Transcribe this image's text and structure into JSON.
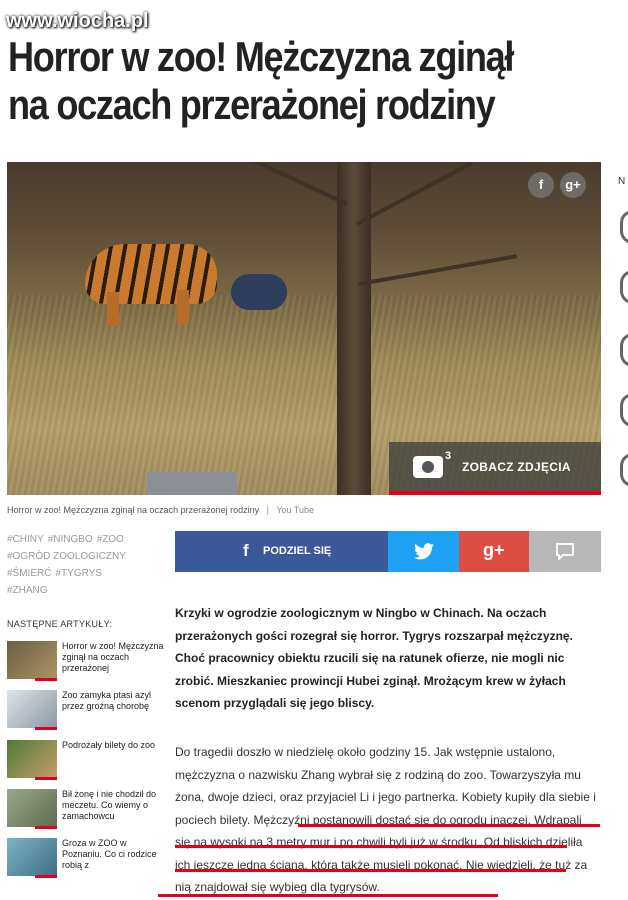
{
  "watermark": "www.wiocha.pl",
  "headline": {
    "line1": "Horror w zoo! Mężczyzna zginął",
    "line2": "na oczach przerażonej rodziny"
  },
  "photo": {
    "share_facebook": "f",
    "share_google": "g+",
    "gallery_count": "3",
    "gallery_label": "ZOBACZ ZDJĘCIA"
  },
  "caption": {
    "text": "Horror w zoo! Mężczyzna zginął na oczach przerażonej rodziny",
    "separator": "|",
    "source": "You Tube"
  },
  "tags": [
    "#CHINY",
    "#NINGBO",
    "#ZOO",
    "#OGRÓD ZOOLOGICZNY",
    "#ŚMIERĆ",
    "#TYGRYS",
    "#ZHANG"
  ],
  "next_articles": {
    "heading": "NASTĘPNE ARTYKUŁY:",
    "items": [
      {
        "title": "Horror w zoo! Mężczyzna zginął na oczach przerażonej",
        "thumb_color": "#8a7a55"
      },
      {
        "title": "Zoo zamyka ptasi azyl przez groźną chorobę",
        "thumb_color": "#b9c2cc"
      },
      {
        "title": "Podrożały bilety do zoo",
        "thumb_color": "#6b8f4a"
      },
      {
        "title": "Bił żonę i nie chodził do meczetu. Co wiemy o zamachowcu",
        "thumb_color": "#8a9a7a"
      },
      {
        "title": "Groza w ZOO w Poznaniu. Co ci rodzice robią z",
        "thumb_color": "#5a8fa5"
      }
    ]
  },
  "share_bar": {
    "facebook_label": "PODZIEL SIĘ",
    "facebook_icon": "f",
    "twitter_icon": "twitter-bird",
    "google_icon": "g+",
    "comment_icon": "comment"
  },
  "lead": "Krzyki w ogrodzie zoologicznym w Ningbo w Chinach. Na oczach przerażonych gości rozegrał się horror. Tygrys rozszarpał mężczyznę. Choć pracownicy obiektu rzucili się na ratunek ofierze, nie mogli nic zrobić. Mieszkaniec prowincji Hubei zginął. Mrożącym krew w żyłach scenom przyglądali się jego bliscy.",
  "body": "Do tragedii doszło w niedzielę około godziny 15. Jak wstępnie ustalono, mężczyzna o nazwisku Zhang wybrał się z rodziną do zoo. Towarzyszyła mu żona, dwoje dzieci, oraz przyjaciel Li i jego partnerka. Kobiety kupiły dla siebie i pociech bilety. Mężczyźni postanowili dostać się do ogrodu inaczej. Wdrapali się na wysoki na 3 metry mur i po chwili byli już w środku. Od bliskich dzieliła ich jeszcze jedna ściana, którą także musieli pokonać. Nie wiedzieli, że tuż za nią znajdował się wybieg dla tygrysów.",
  "sidebar_letter": "N",
  "colors": {
    "accent": "#e2001a",
    "facebook": "#3b5998",
    "twitter": "#1da1f2",
    "google": "#dc4e41",
    "comment": "#b8b8b8"
  }
}
